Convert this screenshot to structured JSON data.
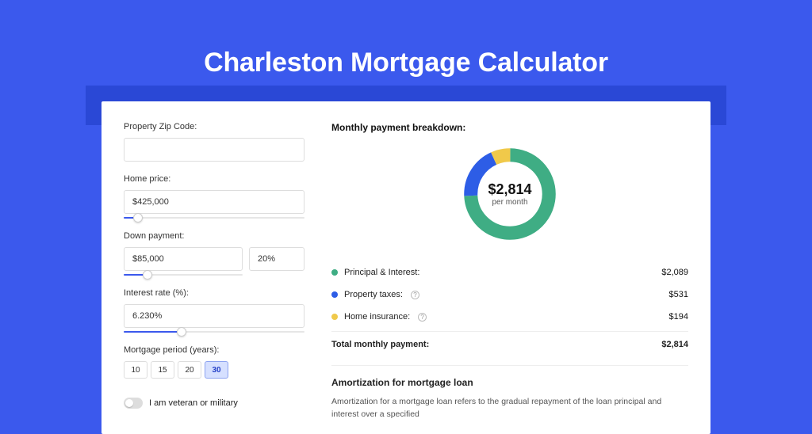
{
  "title": "Charleston Mortgage Calculator",
  "form": {
    "zip_label": "Property Zip Code:",
    "zip_value": "",
    "home_price_label": "Home price:",
    "home_price_value": "$425,000",
    "home_price_slider_pct": 8,
    "down_payment_label": "Down payment:",
    "down_payment_value": "$85,000",
    "down_payment_pct": "20%",
    "down_payment_slider_pct": 20,
    "interest_label": "Interest rate (%):",
    "interest_value": "6.230%",
    "interest_slider_pct": 32,
    "period_label": "Mortgage period (years):",
    "period_options": [
      "10",
      "15",
      "20",
      "30"
    ],
    "period_active": "30",
    "veteran_label": "I am veteran or military"
  },
  "breakdown": {
    "title": "Monthly payment breakdown:",
    "center_value": "$2,814",
    "center_sub": "per month",
    "items": [
      {
        "label": "Principal & Interest:",
        "value": "$2,089",
        "color": "#3fad84",
        "info": false
      },
      {
        "label": "Property taxes:",
        "value": "$531",
        "color": "#2d5de6",
        "info": true
      },
      {
        "label": "Home insurance:",
        "value": "$194",
        "color": "#f0c94a",
        "info": true
      }
    ],
    "total_label": "Total monthly payment:",
    "total_value": "$2,814"
  },
  "amortization": {
    "title": "Amortization for mortgage loan",
    "text": "Amortization for a mortgage loan refers to the gradual repayment of the loan principal and interest over a specified"
  },
  "chart_data": {
    "type": "pie",
    "title": "Monthly payment breakdown",
    "series": [
      {
        "name": "Principal & Interest",
        "value": 2089,
        "color": "#3fad84"
      },
      {
        "name": "Property taxes",
        "value": 531,
        "color": "#2d5de6"
      },
      {
        "name": "Home insurance",
        "value": 194,
        "color": "#f0c94a"
      }
    ],
    "total": 2814,
    "center_label": "$2,814 per month"
  }
}
